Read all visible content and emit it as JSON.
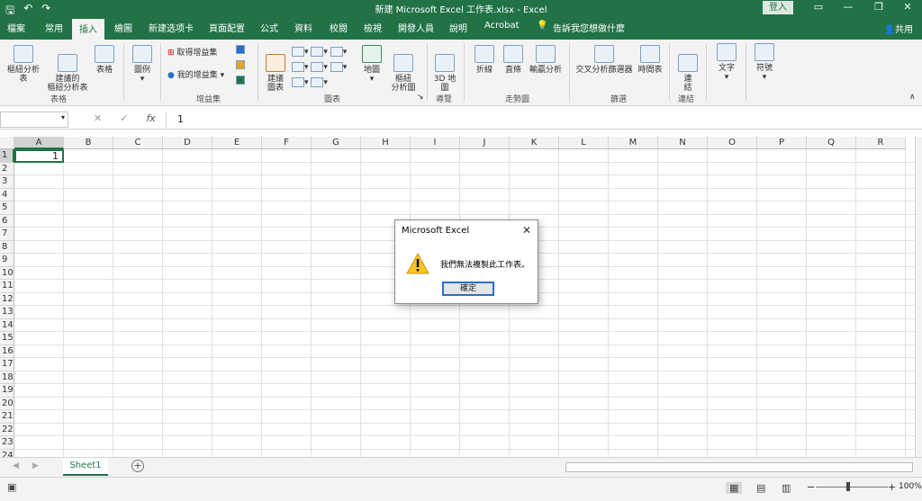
{
  "titlebar": {
    "title": "新建 Microsoft Excel 工作表.xlsx - Excel",
    "signin": "登入",
    "qa_save": "🖫",
    "qa_undo": "↶",
    "qa_redo": "↷"
  },
  "tabs": [
    "檔案",
    "常用",
    "插入",
    "繪圖",
    "新建选项卡",
    "頁面配置",
    "公式",
    "資料",
    "校閱",
    "檢視",
    "開發人員",
    "說明",
    "Acrobat"
  ],
  "active_tab": "插入",
  "tellme": "告訴我您想做什麼",
  "share": "共用",
  "ribbon": {
    "pivot": "樞紐分析表",
    "rec_pivot": "建議的\n樞紐分析表",
    "table": "表格",
    "group_tables": "表格",
    "illus": "圖例",
    "get_addins": "取得增益集",
    "my_addins": "我的增益集",
    "group_addins": "增益集",
    "rec_charts": "建議\n圖表",
    "maps": "地圖",
    "pivot_chart": "樞紐\n分析圖",
    "group_charts": "圖表",
    "map3d": "3D 地\n圖",
    "group_tours": "導覽",
    "line": "折線",
    "column": "直條",
    "winloss": "輸贏分析",
    "group_spark": "走勢圖",
    "slicer": "交叉分析篩選器",
    "timeline": "時間表",
    "group_filters": "篩選",
    "link": "連\n結",
    "group_links": "連結",
    "text": "文字",
    "symbols": "符號"
  },
  "formula": {
    "namebox": "",
    "value": "1",
    "fx": "fx"
  },
  "columns": [
    "A",
    "B",
    "C",
    "D",
    "E",
    "F",
    "G",
    "H",
    "I",
    "J",
    "K",
    "L",
    "M",
    "N",
    "O",
    "P",
    "Q",
    "R"
  ],
  "rows": [
    "1",
    "2",
    "3",
    "4",
    "5",
    "6",
    "7",
    "8",
    "9",
    "10",
    "11",
    "12",
    "13",
    "14",
    "15",
    "16",
    "17",
    "18",
    "19",
    "20",
    "21",
    "22",
    "23",
    "24"
  ],
  "cell_a1": "1",
  "sheet_tab": "Sheet1",
  "zoom": "100%",
  "dialog": {
    "title": "Microsoft Excel",
    "message": "我們無法複製此工作表。",
    "ok": "確定"
  }
}
